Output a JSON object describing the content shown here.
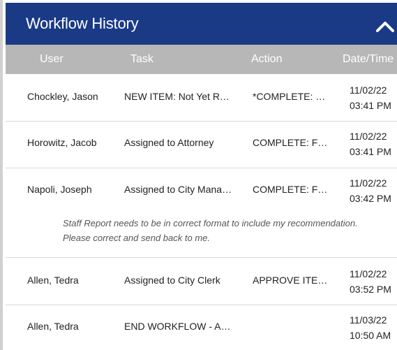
{
  "header": {
    "title": "Workflow History"
  },
  "columns": [
    "User",
    "Task",
    "Action",
    "Date/Time"
  ],
  "rows": [
    {
      "user": "Chockley, Jason",
      "task": "NEW ITEM: Not Yet R…",
      "action": "*COMPLETE: …",
      "date": "11/02/22",
      "time": "03:41 PM"
    },
    {
      "user": "Horowitz, Jacob",
      "task": "Assigned to Attorney",
      "action": "COMPLETE: F…",
      "date": "11/02/22",
      "time": "03:41 PM"
    },
    {
      "user": "Napoli, Joseph",
      "task": "Assigned to City Mana…",
      "action": "COMPLETE: F…",
      "date": "11/02/22",
      "time": "03:42 PM",
      "note": "Staff Report needs to be in correct format to include my recommendation. Please correct and send back to me."
    },
    {
      "user": "Allen, Tedra",
      "task": "Assigned to City Clerk",
      "action": "APPROVE ITE…",
      "date": "11/02/22",
      "time": "03:52 PM"
    },
    {
      "user": "Allen, Tedra",
      "task": "END WORKFLOW - A…",
      "action": "",
      "date": "11/03/22",
      "time": "10:50 AM"
    }
  ],
  "colors": {
    "header_bg": "#1b3a86",
    "column_header_bg": "#b7b7b7"
  },
  "icons": {
    "collapse": "chevron-up-icon"
  }
}
